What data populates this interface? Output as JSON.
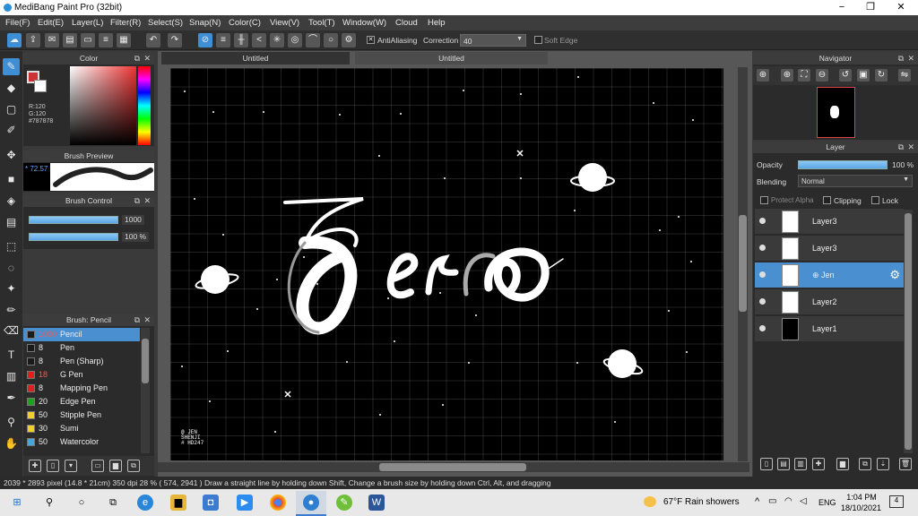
{
  "window": {
    "title": "MediBang Paint Pro (32bit)",
    "minimize": "−",
    "maximize": "❐",
    "close": "✕"
  },
  "menu": [
    "File(F)",
    "Edit(E)",
    "Layer(L)",
    "Filter(R)",
    "Select(S)",
    "Snap(N)",
    "Color(C)",
    "View(V)",
    "Tool(T)",
    "Window(W)",
    "Cloud",
    "Help"
  ],
  "toolbar": {
    "antialias": "AntiAliasing",
    "correction_label": "Correction",
    "correction_value": "40",
    "soft_edge": "Soft Edge"
  },
  "color_panel": {
    "title": "Color",
    "r": "R:120",
    "g": "G:120",
    "b": "B:120",
    "hex": "#787878"
  },
  "brush_preview": {
    "title": "Brush Preview",
    "size": "* 72.57"
  },
  "brush_control": {
    "title": "Brush Control",
    "size": "1000",
    "opacity": "100 %"
  },
  "brush_list": {
    "title": "Brush: Pencil",
    "items": [
      {
        "n": "1000",
        "name": "Pencil",
        "color": "#1a1a1a",
        "sel": true
      },
      {
        "n": "8",
        "name": "Pen",
        "color": "#1a1a1a"
      },
      {
        "n": "8",
        "name": "Pen (Sharp)",
        "color": "#1a1a1a"
      },
      {
        "n": "18",
        "name": "G Pen",
        "color": "#e02020"
      },
      {
        "n": "8",
        "name": "Mapping Pen",
        "color": "#e02020"
      },
      {
        "n": "20",
        "name": "Edge Pen",
        "color": "#20a020"
      },
      {
        "n": "50",
        "name": "Stipple Pen",
        "color": "#f0d020"
      },
      {
        "n": "30",
        "name": "Sumi",
        "color": "#f0d020"
      },
      {
        "n": "50",
        "name": "Watercolor",
        "color": "#40a8e0"
      }
    ]
  },
  "tabs": [
    "Untitled",
    "Untitled"
  ],
  "artwork": {
    "title_text": "Zero",
    "signature": "@ JEN\nSHENJI\n# HD247"
  },
  "navigator": {
    "title": "Navigator"
  },
  "layer_panel": {
    "title": "Layer",
    "opacity_label": "Opacity",
    "opacity_value": "100 %",
    "blending_label": "Blending",
    "blending_value": "Normal",
    "protect_alpha": "Protect Alpha",
    "clipping": "Clipping",
    "lock": "Lock",
    "layers": [
      {
        "name": "Layer3"
      },
      {
        "name": "Layer3"
      },
      {
        "name": "⊕ Jen",
        "sel": true
      },
      {
        "name": "Layer2"
      },
      {
        "name": "Layer1",
        "dark": true
      }
    ]
  },
  "status": "2039 * 2893 pixel  (14.8 * 21cm)  350 dpi  28 %  ( 574, 2941 )  Draw a straight line by holding down Shift, Change a brush size by holding down Ctrl, Alt, and dragging",
  "taskbar": {
    "weather": "67°F  Rain showers",
    "lang": "ENG",
    "time": "1:04 PM",
    "date": "18/10/2021",
    "notif": "4"
  }
}
